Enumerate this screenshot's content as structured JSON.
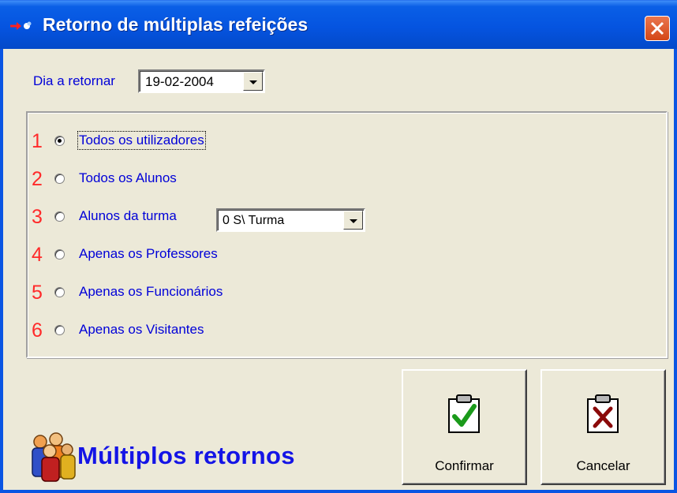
{
  "window": {
    "title": "Retorno de múltiplas refeições",
    "close_label": "Close",
    "accent_color": "#0a55e3"
  },
  "date_field": {
    "label": "Dia a retornar",
    "value": "19-02-2004"
  },
  "options": [
    {
      "number": "1",
      "label": "Todos os utilizadores",
      "selected": true
    },
    {
      "number": "2",
      "label": "Todos os Alunos",
      "selected": false
    },
    {
      "number": "3",
      "label": "Alunos da turma",
      "selected": false
    },
    {
      "number": "4",
      "label": "Apenas os Professores",
      "selected": false
    },
    {
      "number": "5",
      "label": "Apenas os Funcionários",
      "selected": false
    },
    {
      "number": "6",
      "label": "Apenas os Visitantes",
      "selected": false
    }
  ],
  "turma_select": {
    "value": "0 S\\ Turma"
  },
  "buttons": {
    "confirm": "Confirmar",
    "cancel": "Cancelar"
  },
  "footer": {
    "logo_text": "Múltiplos retornos",
    "icons": [
      "users-group-icon",
      "clipboard-check-icon",
      "clipboard-x-icon"
    ]
  }
}
